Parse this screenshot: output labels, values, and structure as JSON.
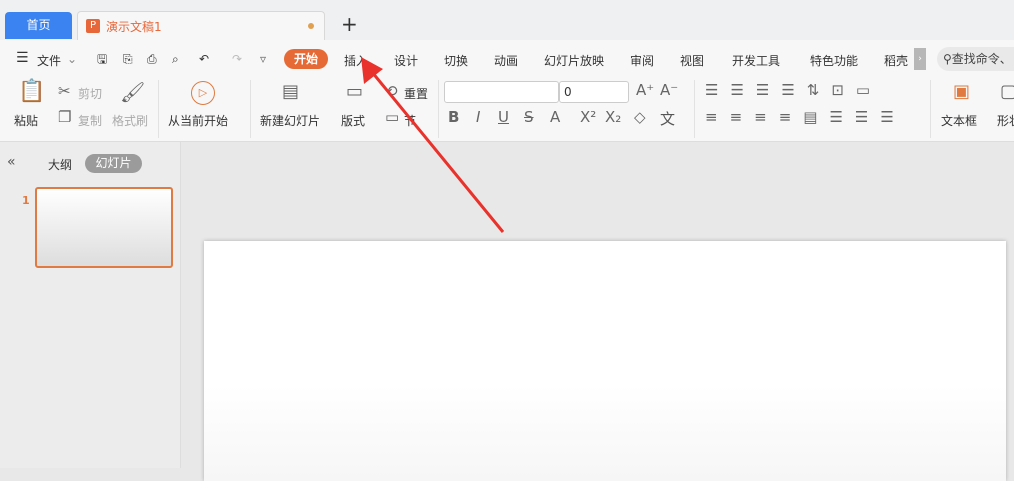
{
  "tabs": {
    "home": "首页",
    "doc_icon": "P",
    "doc_title": "演示文稿1",
    "new_tab": "+"
  },
  "menu": {
    "file": "文件",
    "items": [
      "开始",
      "插入",
      "设计",
      "切换",
      "动画",
      "幻灯片放映",
      "审阅",
      "视图",
      "开发工具",
      "特色功能",
      "稻壳"
    ],
    "search_placeholder": "查找命令、"
  },
  "ribbon": {
    "paste": "粘贴",
    "cut": "剪切",
    "copy": "复制",
    "format_painter": "格式刷",
    "play_from_current": "从当前开始",
    "new_slide": "新建幻灯片",
    "layout": "版式",
    "reset": "重置",
    "section": "节",
    "font_size": "0",
    "text_box": "文本框",
    "shape": "形状"
  },
  "panel": {
    "outline": "大纲",
    "slides": "幻灯片",
    "slide_number": "1"
  },
  "colors": {
    "accent": "#e56a35",
    "home_tab": "#3b83f0",
    "arrow": "#e8322b"
  }
}
